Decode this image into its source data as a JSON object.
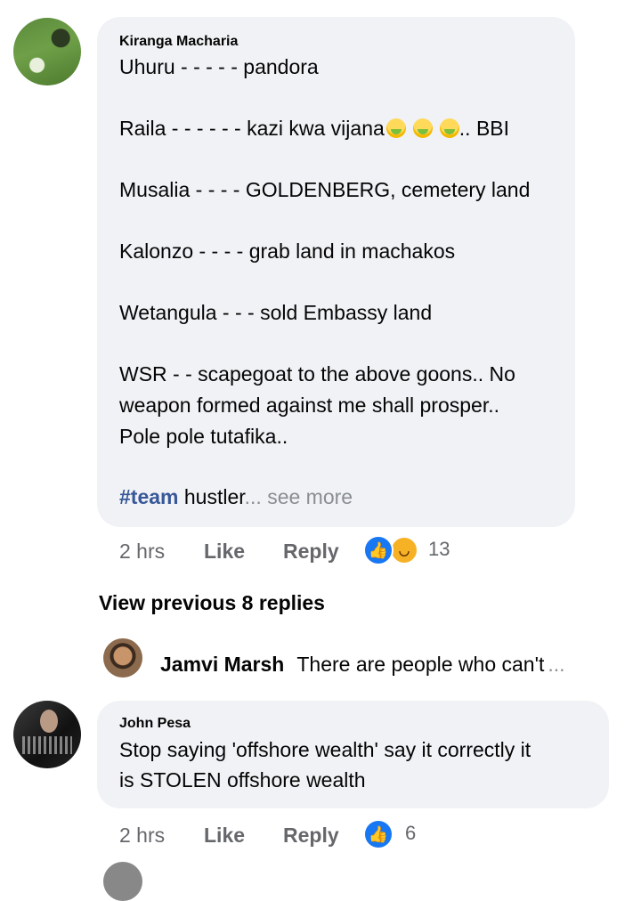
{
  "comment1": {
    "author": "Kiranga Macharia",
    "lines": [
      "Uhuru - - - - - pandora",
      "Raila - - - - - - kazi kwa vijana",
      "Musalia - - - - GOLDENBERG, cemetery land",
      "Kalonzo - - - - grab land in machakos",
      "Wetangula - - - sold Embassy land",
      "WSR - - scapegoat to the above goons.. No",
      "weapon formed against me shall prosper..",
      "Pole pole tutafika.."
    ],
    "raila_suffix": ".. BBI",
    "hashtag": "#team",
    "hashtag_rest": " hustler",
    "see_more": "... see more",
    "time": "2 hrs",
    "like_label": "Like",
    "reply_label": "Reply",
    "reaction_count": "13"
  },
  "view_previous": "View previous 8 replies",
  "reply_preview": {
    "name": "Jamvi Marsh",
    "text": "There are people who can't",
    "ellipsis": "..."
  },
  "comment2": {
    "author": "John Pesa",
    "lines": [
      "Stop saying 'offshore wealth' say it correctly it",
      "is STOLEN offshore wealth"
    ],
    "time": "2 hrs",
    "like_label": "Like",
    "reply_label": "Reply",
    "reaction_count": "6"
  },
  "icons": {
    "like": "like-icon",
    "haha": "haha-icon",
    "emoji": "face-vomiting-emoji"
  },
  "colors": {
    "bubble": "#f0f2f5",
    "like_blue": "#1877f2",
    "hashtag": "#385898",
    "meta": "#65676b"
  }
}
